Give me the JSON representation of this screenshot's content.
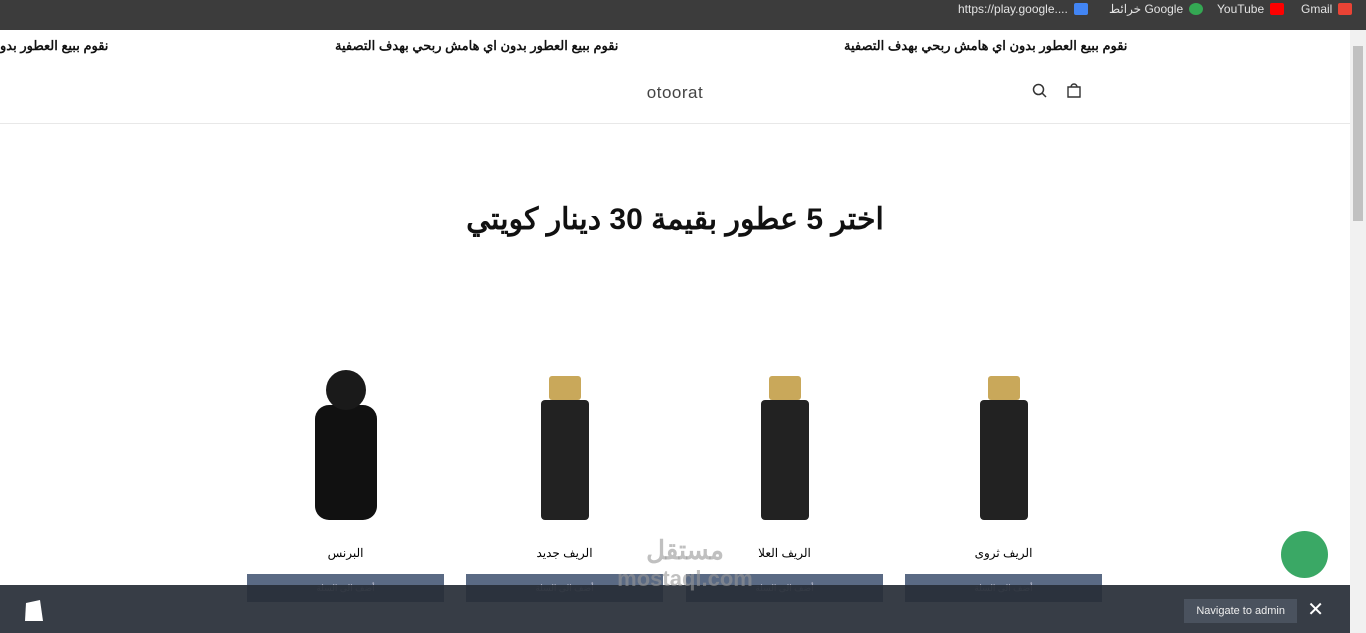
{
  "bookmarks": [
    {
      "label": "Gmail",
      "icon": "gmail-icon"
    },
    {
      "label": "YouTube",
      "icon": "youtube-icon"
    },
    {
      "label": "خرائط Google",
      "icon": "maps-icon"
    },
    {
      "label": "https://play.google....",
      "icon": "play-icon"
    }
  ],
  "announcement": "نقوم ببيع العطور بدون اي هامش ربحي بهدف التصفية",
  "announcement_cut": "نقوم ببيع العطور بدو",
  "header": {
    "logo": "otoorat"
  },
  "main": {
    "title": "اختر 5 عطور بقيمة 30 دينار كويتي"
  },
  "products": [
    {
      "name": "البرنس",
      "button": "أضف الى السلة"
    },
    {
      "name": "الريف جديد",
      "button": "أضف الى السلة"
    },
    {
      "name": "الريف العلا",
      "button": "أضف الى السلة"
    },
    {
      "name": "الريف ثروى",
      "button": "أضف الى السلة"
    }
  ],
  "admin_bar": {
    "navigate": "Navigate to admin"
  },
  "watermark": {
    "arabic": "مستقل",
    "latin": "mostaql.com"
  }
}
